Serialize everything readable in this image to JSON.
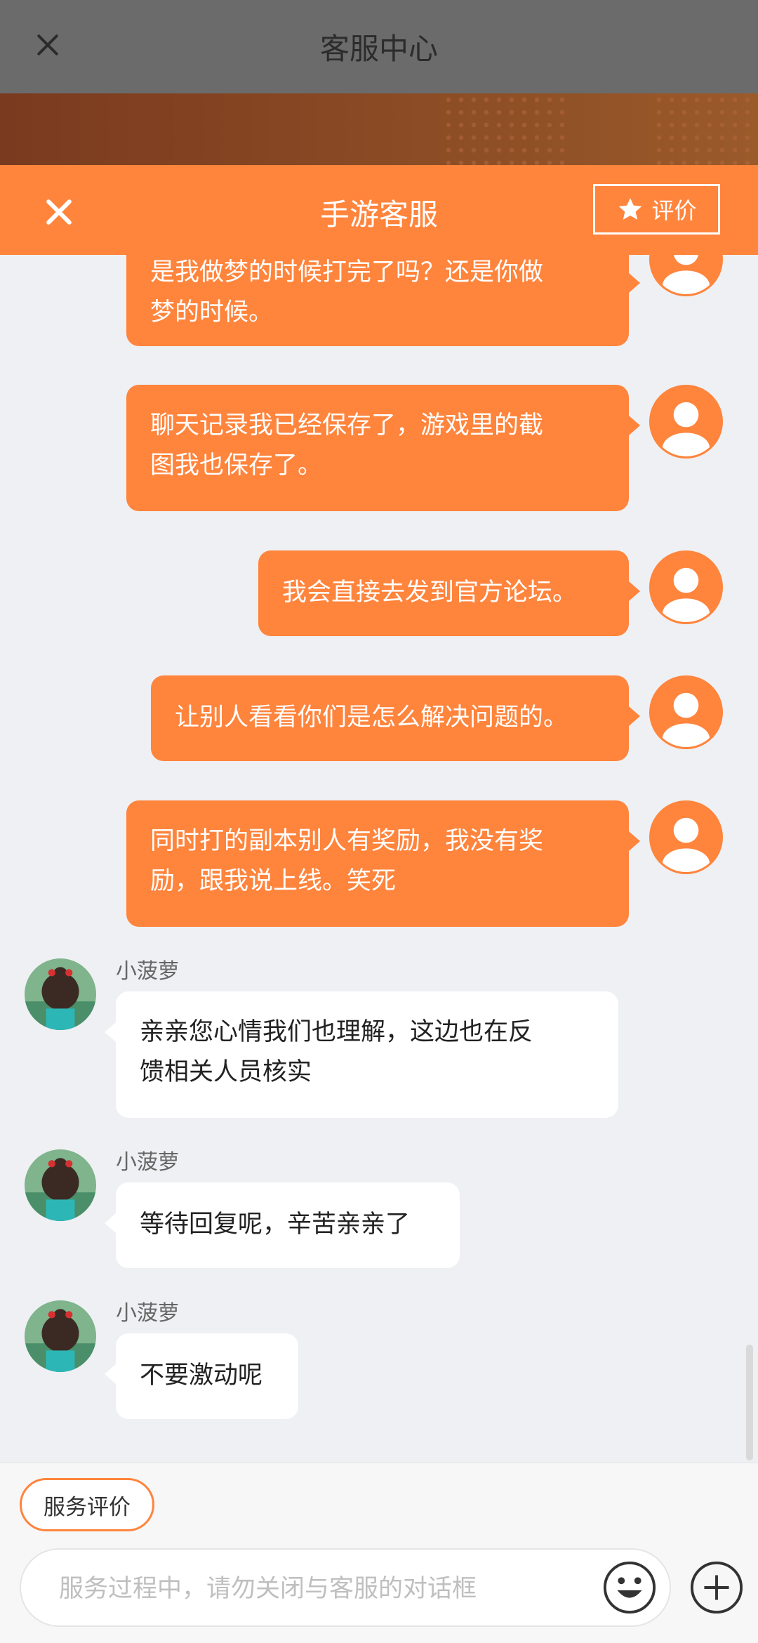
{
  "background_page": {
    "title": "客服中心"
  },
  "chat": {
    "title": "手游客服",
    "rate_label": "评价"
  },
  "messages_user": [
    {
      "lines": [
        "是我做梦的时候打完了吗？还是你做",
        "梦的时候。"
      ]
    },
    {
      "lines": [
        "聊天记录我已经保存了，游戏里的截",
        "图我也保存了。"
      ]
    },
    {
      "lines": [
        "我会直接去发到官方论坛。"
      ]
    },
    {
      "lines": [
        "让别人看看你们是怎么解决问题的。"
      ]
    },
    {
      "lines": [
        "同时打的副本别人有奖励，我没有奖",
        "励，跟我说上线。笑死"
      ]
    }
  ],
  "messages_agent": [
    {
      "name": "小菠萝",
      "lines": [
        "亲亲您心情我们也理解，这边也在反",
        "馈相关人员核实"
      ]
    },
    {
      "name": "小菠萝",
      "lines": [
        "等待回复呢，辛苦亲亲了"
      ]
    },
    {
      "name": "小菠萝",
      "lines": [
        "不要激动呢"
      ]
    }
  ],
  "footer": {
    "service_rating_label": "服务评价",
    "input_placeholder": "服务过程中，请勿关闭与客服的对话框"
  },
  "colors": {
    "accent": "#ff843c",
    "agent_bubble": "#ffffff",
    "background": "#eff0f3"
  },
  "icons": [
    "close-icon",
    "star-icon",
    "user-avatar-icon",
    "emoji-icon",
    "plus-icon"
  ]
}
